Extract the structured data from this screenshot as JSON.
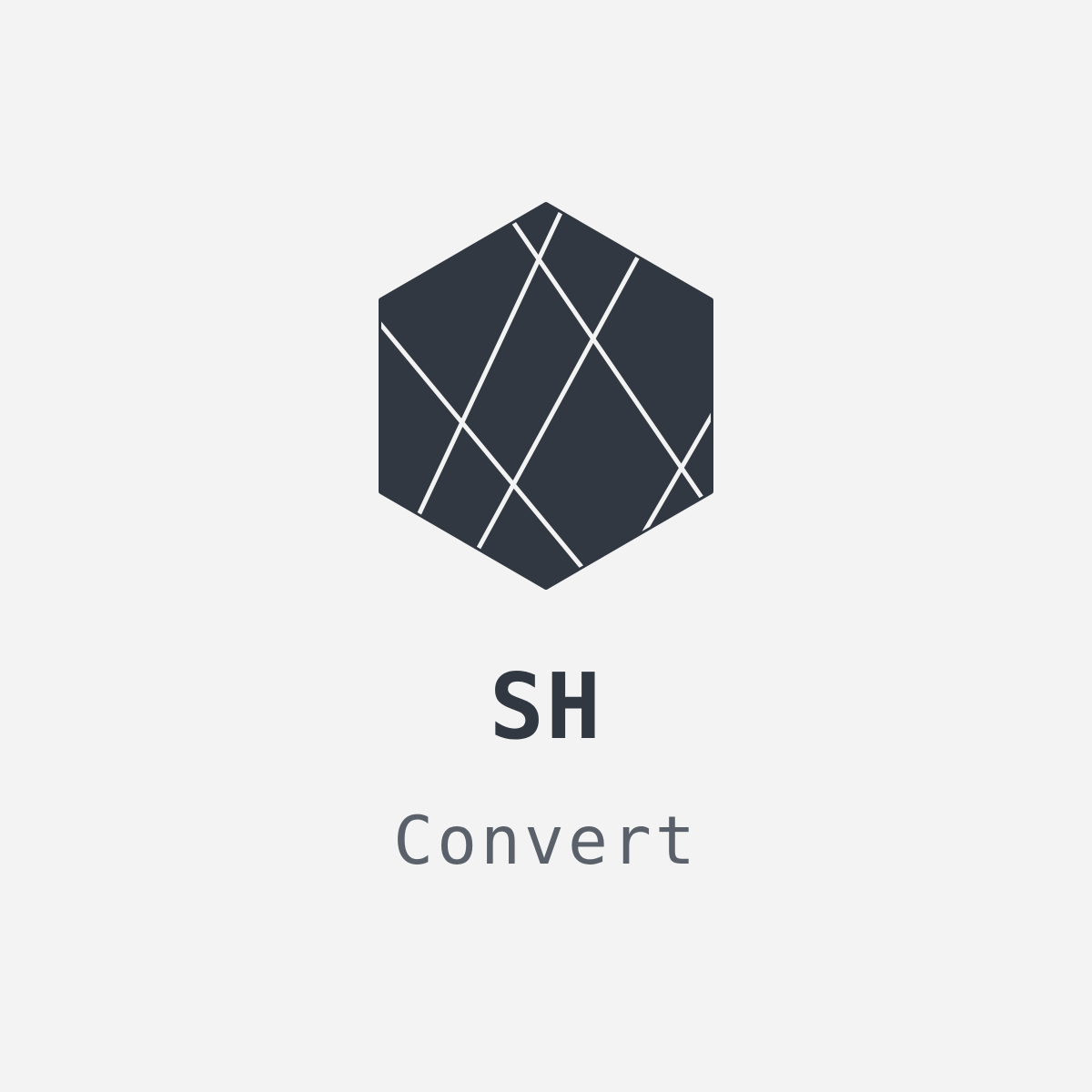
{
  "brand": {
    "title": "SH",
    "subtitle": "Convert"
  },
  "logo": {
    "icon": "faceted-hexagon-icon",
    "fill_color": "#313842",
    "line_color": "#f3f3f3"
  },
  "colors": {
    "background": "#f3f3f3",
    "title": "#313842",
    "subtitle": "#5a616b"
  }
}
